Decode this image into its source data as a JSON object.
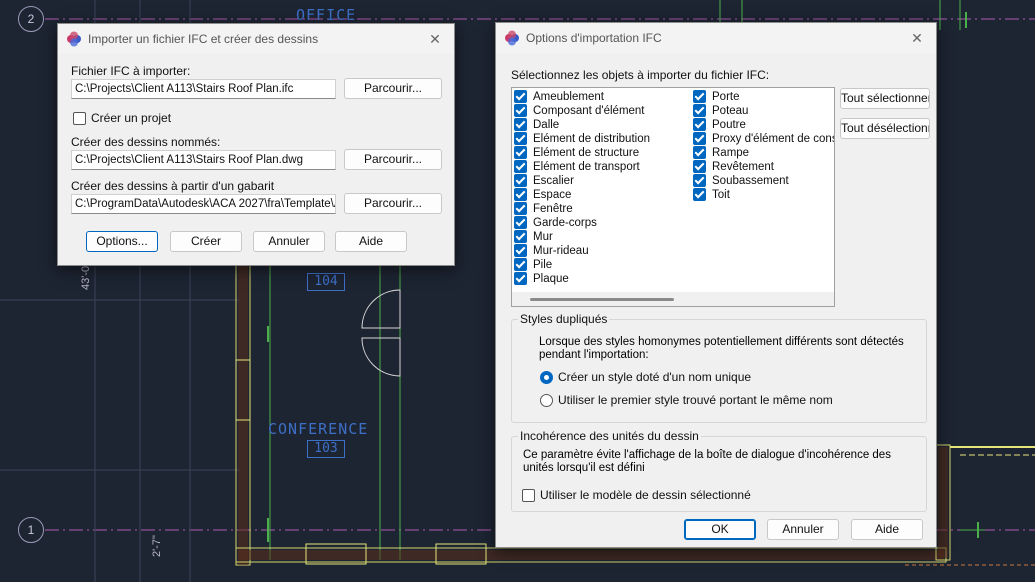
{
  "cad": {
    "office_label": "OFFICE",
    "room_104": "104",
    "conference_label": "CONFERENCE",
    "room_103": "103",
    "grid_2": "2",
    "grid_1": "1",
    "dim_left_top": "43'-0\"",
    "dim_left_bottom": "2'-7\""
  },
  "import_dialog": {
    "title": "Importer un fichier IFC et créer des dessins",
    "ifc_file_label": "Fichier IFC à importer:",
    "ifc_file_value": "C:\\Projects\\Client A113\\Stairs Roof Plan.ifc",
    "browse_label": "Parcourir...",
    "create_project_label": "Créer un projet",
    "named_drawings_label": "Créer des dessins nommés:",
    "named_drawings_value": "C:\\Projects\\Client A113\\Stairs Roof Plan.dwg",
    "template_label": "Créer des dessins à partir d'un gabarit",
    "template_value": "C:\\ProgramData\\Autodesk\\ACA 2027\\fra\\Template\\AEC Model (Metric Ctb).dwt",
    "options_label": "Options...",
    "create_label": "Créer",
    "cancel_label": "Annuler",
    "help_label": "Aide"
  },
  "options_dialog": {
    "title": "Options d'importation IFC",
    "select_objects_label": "Sélectionnez les objets à importer du fichier IFC:",
    "objects_col1": [
      "Ameublement",
      "Composant d'élément",
      "Dalle",
      "Elément de distribution",
      "Elément de structure",
      "Elément de transport",
      "Escalier",
      "Espace",
      "Fenêtre",
      "Garde-corps",
      "Mur",
      "Mur-rideau",
      "Pile",
      "Plaque"
    ],
    "objects_col2": [
      "Porte",
      "Poteau",
      "Poutre",
      "Proxy d'élément de construction",
      "Rampe",
      "Revêtement",
      "Soubassement",
      "Toit"
    ],
    "select_all_label": "Tout sélectionner",
    "deselect_all_label": "Tout désélectionner",
    "dup_styles_title": "Styles dupliqués",
    "dup_styles_desc": "Lorsque des styles homonymes potentiellement différents sont détectés pendant l'importation:",
    "create_unique_label": "Créer un style doté d'un nom unique",
    "use_first_label": "Utiliser le premier style trouvé portant le même nom",
    "units_title": "Incohérence des unités du dessin",
    "units_desc": "Ce paramètre évite l'affichage de la boîte de dialogue d'incohérence des unités lorsqu'il est défini",
    "use_template_label": "Utiliser le modèle de dessin sélectionné",
    "ok_label": "OK",
    "cancel_label": "Annuler",
    "help_label": "Aide"
  }
}
